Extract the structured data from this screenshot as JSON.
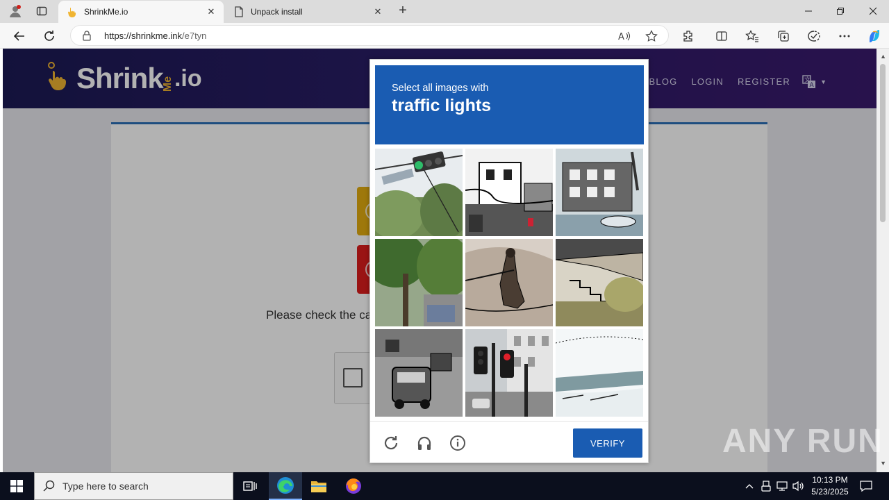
{
  "browser": {
    "tabs": [
      {
        "title": "ShrinkMe.io",
        "active": true
      },
      {
        "title": "Unpack install",
        "active": false
      }
    ],
    "url_host": "https://shrinkme.ink",
    "url_path": "/e7tyn"
  },
  "site": {
    "logo_main": "Shrink",
    "logo_me": "Me",
    "logo_io": ".io",
    "nav": [
      "BLOG",
      "LOGIN",
      "REGISTER"
    ],
    "please_text": "Please check the ca"
  },
  "captcha": {
    "instruction": "Select all images with",
    "target": "traffic lights",
    "verify_label": "VERIFY"
  },
  "watermark": "ANY RUN",
  "taskbar": {
    "search_placeholder": "Type here to search",
    "time": "10:13 PM",
    "date": "5/23/2025"
  },
  "colors": {
    "captcha_blue": "#1a5cb2",
    "header_purple": "#2a1d66",
    "logo_gold": "#f0b431"
  }
}
